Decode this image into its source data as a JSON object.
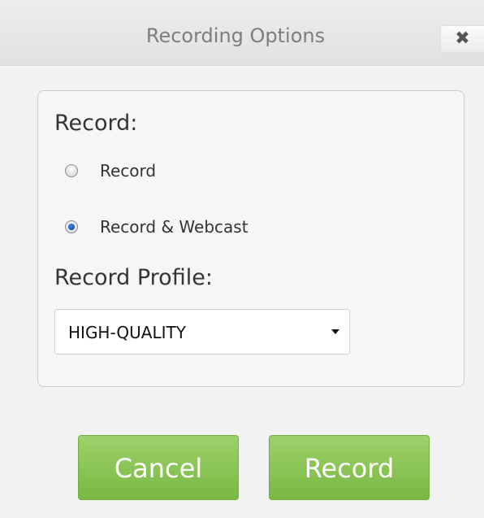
{
  "dialog": {
    "title": "Recording Options",
    "close_icon": "close-icon",
    "close_glyph": "✖"
  },
  "record": {
    "label": "Record:",
    "options": [
      {
        "label": "Record",
        "selected": false
      },
      {
        "label": "Record & Webcast",
        "selected": true
      }
    ]
  },
  "profile": {
    "label": "Record Profile:",
    "selected": "HIGH-QUALITY"
  },
  "buttons": {
    "cancel": "Cancel",
    "record": "Record"
  },
  "colors": {
    "button_green": "#8cc657",
    "radio_checked": "#1a5fc0"
  }
}
